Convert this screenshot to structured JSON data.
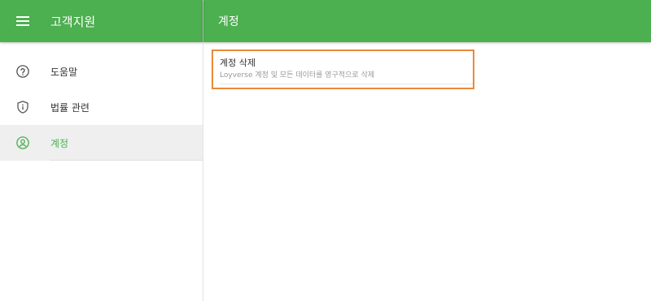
{
  "sidebar": {
    "title": "고객지원",
    "menu_icon": "hamburger-menu-icon",
    "items": [
      {
        "label": "도움말",
        "icon": "help-circle-icon",
        "active": false
      },
      {
        "label": "법률 관련",
        "icon": "shield-info-icon",
        "active": false
      },
      {
        "label": "계정",
        "icon": "account-circle-icon",
        "active": true
      }
    ]
  },
  "main": {
    "title": "계정",
    "settings": [
      {
        "title": "계정 삭제",
        "description": "Loyverse 계정 및 모든 데이터를 영구적으로 삭제"
      }
    ]
  },
  "colors": {
    "header": "#4caf50",
    "accent": "#4caf50",
    "highlight_border": "#e8893a",
    "active_bg": "#efefef"
  }
}
